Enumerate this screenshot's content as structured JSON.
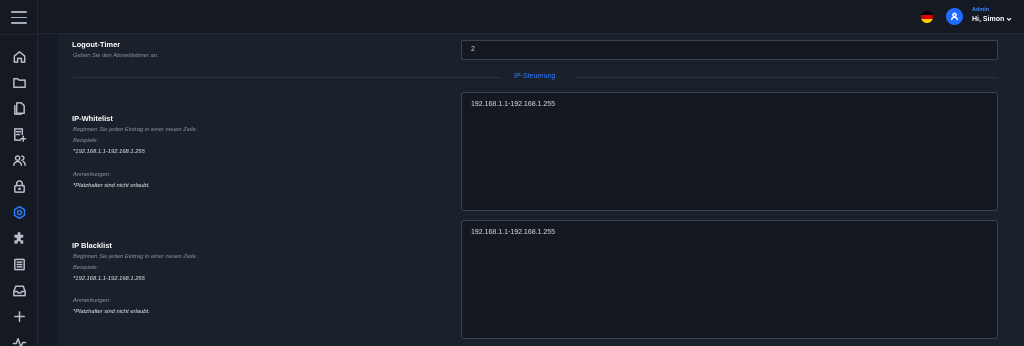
{
  "header": {
    "role": "Admin",
    "greeting": "Hi, Simon",
    "flag_colors": [
      "#000000",
      "#dd0000",
      "#ffce00"
    ]
  },
  "sidebar": {
    "items": [
      {
        "icon": "home-icon",
        "active": false
      },
      {
        "icon": "folder-icon",
        "active": false
      },
      {
        "icon": "documents-icon",
        "active": false
      },
      {
        "icon": "invoice-icon",
        "active": false
      },
      {
        "icon": "users-icon",
        "active": false
      },
      {
        "icon": "lock-icon",
        "active": false
      },
      {
        "icon": "settings-icon",
        "active": true
      },
      {
        "icon": "puzzle-icon",
        "active": false
      },
      {
        "icon": "list-icon",
        "active": false
      },
      {
        "icon": "inbox-icon",
        "active": false
      },
      {
        "icon": "plus-icon",
        "active": false
      },
      {
        "icon": "activity-icon",
        "active": false
      }
    ]
  },
  "logout": {
    "label": "Logout-Timer",
    "hint": "Geben Sie den Abmeldetimer an.",
    "value": "2"
  },
  "section": {
    "title": "IP-Steuerung"
  },
  "whitelist": {
    "label": "IP-Whitelist",
    "hint_line": "Beginnen Sie jeden Eintrag in einer neuen Zeile.",
    "example_label": "Beispiele:",
    "example": "*192.168.1.1-192.168.1.255",
    "notes_label": "Anmerkungen:",
    "note": "*Platzhalter sind nicht erlaubt.",
    "value": "192.168.1.1-192.168.1.255"
  },
  "blacklist": {
    "label": "IP Blacklist",
    "hint_line": "Beginnen Sie jeden Eintrag in einer neuen Zeile.",
    "example_label": "Beispiele:",
    "example": "*192.168.1.1-192.168.1.255",
    "notes_label": "Anmerkungen:",
    "note": "*Platzhalter sind nicht erlaubt.",
    "value": "192.168.1.1-192.168.1.255"
  },
  "colors": {
    "accent": "#2f7bff",
    "background": "#161b25",
    "panel": "#1b212b"
  }
}
